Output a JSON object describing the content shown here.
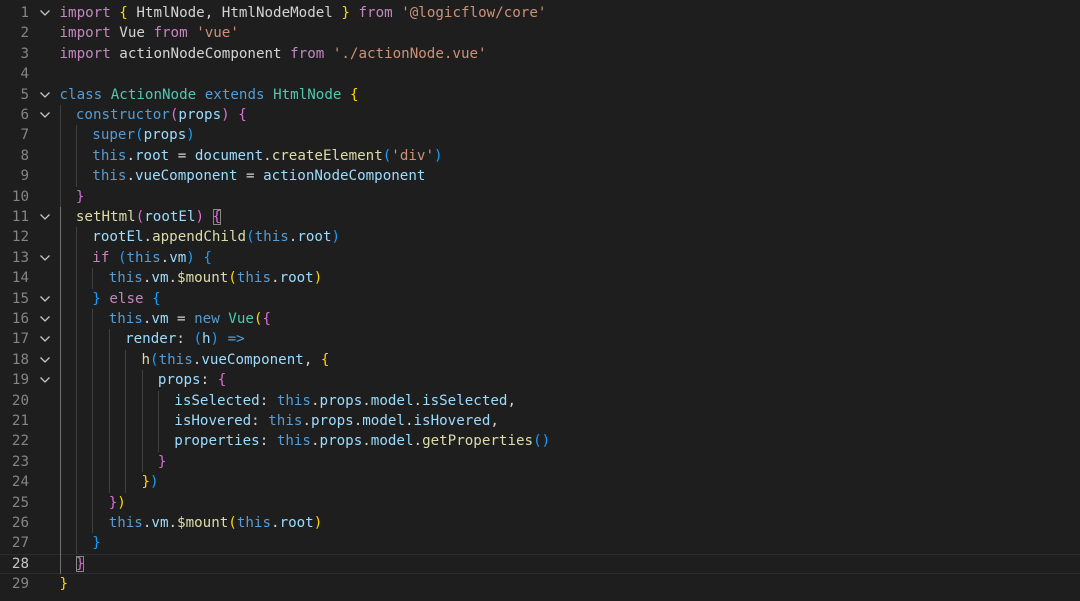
{
  "colors": {
    "background": "#1e1e1e",
    "line_number": "#858585",
    "line_number_active": "#c6c6c6",
    "keyword_import": "#c586c0",
    "keyword": "#569cd6",
    "class_name": "#4ec9b0",
    "variable": "#9cdcfe",
    "function": "#dcdcaa",
    "string": "#ce9178",
    "plain": "#d4d4d4",
    "bracket_1": "#ffd700",
    "bracket_2": "#da70d6",
    "bracket_3": "#179fff"
  },
  "editor": {
    "active_line": 28,
    "lines": [
      {
        "n": "1",
        "fold": true,
        "indent": 0,
        "tokens": [
          [
            "import",
            "k"
          ],
          [
            " ",
            "p"
          ],
          [
            "{",
            "b1"
          ],
          [
            " HtmlNode, HtmlNodeModel ",
            "p"
          ],
          [
            "}",
            "b1"
          ],
          [
            " ",
            "p"
          ],
          [
            "from",
            "k"
          ],
          [
            " ",
            "p"
          ],
          [
            "'@logicflow/core'",
            "s"
          ]
        ]
      },
      {
        "n": "2",
        "fold": false,
        "indent": 0,
        "tokens": [
          [
            "import",
            "k"
          ],
          [
            " Vue ",
            "p"
          ],
          [
            "from",
            "k"
          ],
          [
            " ",
            "p"
          ],
          [
            "'vue'",
            "s"
          ]
        ]
      },
      {
        "n": "3",
        "fold": false,
        "indent": 0,
        "tokens": [
          [
            "import",
            "k"
          ],
          [
            " actionNodeComponent ",
            "p"
          ],
          [
            "from",
            "k"
          ],
          [
            " ",
            "p"
          ],
          [
            "'./actionNode.vue'",
            "s"
          ]
        ]
      },
      {
        "n": "4",
        "fold": false,
        "indent": 0,
        "tokens": []
      },
      {
        "n": "5",
        "fold": true,
        "indent": 0,
        "tokens": [
          [
            "class",
            "kw"
          ],
          [
            " ",
            "p"
          ],
          [
            "ActionNode",
            "c"
          ],
          [
            " ",
            "p"
          ],
          [
            "extends",
            "kw"
          ],
          [
            " ",
            "p"
          ],
          [
            "HtmlNode",
            "c"
          ],
          [
            " ",
            "p"
          ],
          [
            "{",
            "b1"
          ]
        ]
      },
      {
        "n": "6",
        "fold": true,
        "indent": 1,
        "tokens": [
          [
            "constructor",
            "kw"
          ],
          [
            "(",
            "b2"
          ],
          [
            "props",
            "v"
          ],
          [
            ")",
            "b2"
          ],
          [
            " ",
            "p"
          ],
          [
            "{",
            "b2"
          ]
        ]
      },
      {
        "n": "7",
        "fold": false,
        "indent": 2,
        "tokens": [
          [
            "super",
            "kw"
          ],
          [
            "(",
            "b3"
          ],
          [
            "props",
            "v"
          ],
          [
            ")",
            "b3"
          ]
        ]
      },
      {
        "n": "8",
        "fold": false,
        "indent": 2,
        "tokens": [
          [
            "this",
            "kw"
          ],
          [
            ".",
            "p"
          ],
          [
            "root",
            "v"
          ],
          [
            " = ",
            "p"
          ],
          [
            "document",
            "v"
          ],
          [
            ".",
            "p"
          ],
          [
            "createElement",
            "f"
          ],
          [
            "(",
            "b3"
          ],
          [
            "'div'",
            "s"
          ],
          [
            ")",
            "b3"
          ]
        ]
      },
      {
        "n": "9",
        "fold": false,
        "indent": 2,
        "tokens": [
          [
            "this",
            "kw"
          ],
          [
            ".",
            "p"
          ],
          [
            "vueComponent",
            "v"
          ],
          [
            " = ",
            "p"
          ],
          [
            "actionNodeComponent",
            "v"
          ]
        ]
      },
      {
        "n": "10",
        "fold": false,
        "indent": 1,
        "tokens": [
          [
            "}",
            "b2"
          ]
        ]
      },
      {
        "n": "11",
        "fold": true,
        "indent": 1,
        "tokens": [
          [
            "setHtml",
            "f"
          ],
          [
            "(",
            "b2"
          ],
          [
            "rootEl",
            "v"
          ],
          [
            ")",
            "b2"
          ],
          [
            " ",
            "p"
          ],
          [
            "{",
            "b2m"
          ]
        ]
      },
      {
        "n": "12",
        "fold": false,
        "indent": 2,
        "tokens": [
          [
            "rootEl",
            "v"
          ],
          [
            ".",
            "p"
          ],
          [
            "appendChild",
            "f"
          ],
          [
            "(",
            "b3"
          ],
          [
            "this",
            "kw"
          ],
          [
            ".",
            "p"
          ],
          [
            "root",
            "v"
          ],
          [
            ")",
            "b3"
          ]
        ]
      },
      {
        "n": "13",
        "fold": true,
        "indent": 2,
        "tokens": [
          [
            "if",
            "k"
          ],
          [
            " ",
            "p"
          ],
          [
            "(",
            "b3"
          ],
          [
            "this",
            "kw"
          ],
          [
            ".",
            "p"
          ],
          [
            "vm",
            "v"
          ],
          [
            ")",
            "b3"
          ],
          [
            " ",
            "p"
          ],
          [
            "{",
            "b3"
          ]
        ]
      },
      {
        "n": "14",
        "fold": false,
        "indent": 3,
        "tokens": [
          [
            "this",
            "kw"
          ],
          [
            ".",
            "p"
          ],
          [
            "vm",
            "v"
          ],
          [
            ".",
            "p"
          ],
          [
            "$mount",
            "f"
          ],
          [
            "(",
            "b1"
          ],
          [
            "this",
            "kw"
          ],
          [
            ".",
            "p"
          ],
          [
            "root",
            "v"
          ],
          [
            ")",
            "b1"
          ]
        ]
      },
      {
        "n": "15",
        "fold": true,
        "indent": 2,
        "tokens": [
          [
            "}",
            "b3"
          ],
          [
            " ",
            "p"
          ],
          [
            "else",
            "k"
          ],
          [
            " ",
            "p"
          ],
          [
            "{",
            "b3"
          ]
        ]
      },
      {
        "n": "16",
        "fold": true,
        "indent": 3,
        "tokens": [
          [
            "this",
            "kw"
          ],
          [
            ".",
            "p"
          ],
          [
            "vm",
            "v"
          ],
          [
            " = ",
            "p"
          ],
          [
            "new",
            "kw"
          ],
          [
            " ",
            "p"
          ],
          [
            "Vue",
            "c"
          ],
          [
            "(",
            "b1"
          ],
          [
            "{",
            "b2"
          ]
        ]
      },
      {
        "n": "17",
        "fold": true,
        "indent": 4,
        "tokens": [
          [
            "render",
            "v"
          ],
          [
            ": ",
            "p"
          ],
          [
            "(",
            "b3"
          ],
          [
            "h",
            "v"
          ],
          [
            ")",
            "b3"
          ],
          [
            " ",
            "p"
          ],
          [
            "=>",
            "kw"
          ]
        ]
      },
      {
        "n": "18",
        "fold": true,
        "indent": 5,
        "tokens": [
          [
            "h",
            "f"
          ],
          [
            "(",
            "b3"
          ],
          [
            "this",
            "kw"
          ],
          [
            ".",
            "p"
          ],
          [
            "vueComponent",
            "v"
          ],
          [
            ", ",
            "p"
          ],
          [
            "{",
            "b1"
          ]
        ]
      },
      {
        "n": "19",
        "fold": true,
        "indent": 6,
        "tokens": [
          [
            "props",
            "v"
          ],
          [
            ": ",
            "p"
          ],
          [
            "{",
            "b2"
          ]
        ]
      },
      {
        "n": "20",
        "fold": false,
        "indent": 7,
        "tokens": [
          [
            "isSelected",
            "v"
          ],
          [
            ": ",
            "p"
          ],
          [
            "this",
            "kw"
          ],
          [
            ".",
            "p"
          ],
          [
            "props",
            "v"
          ],
          [
            ".",
            "p"
          ],
          [
            "model",
            "v"
          ],
          [
            ".",
            "p"
          ],
          [
            "isSelected",
            "v"
          ],
          [
            ",",
            "p"
          ]
        ]
      },
      {
        "n": "21",
        "fold": false,
        "indent": 7,
        "tokens": [
          [
            "isHovered",
            "v"
          ],
          [
            ": ",
            "p"
          ],
          [
            "this",
            "kw"
          ],
          [
            ".",
            "p"
          ],
          [
            "props",
            "v"
          ],
          [
            ".",
            "p"
          ],
          [
            "model",
            "v"
          ],
          [
            ".",
            "p"
          ],
          [
            "isHovered",
            "v"
          ],
          [
            ",",
            "p"
          ]
        ]
      },
      {
        "n": "22",
        "fold": false,
        "indent": 7,
        "tokens": [
          [
            "properties",
            "v"
          ],
          [
            ": ",
            "p"
          ],
          [
            "this",
            "kw"
          ],
          [
            ".",
            "p"
          ],
          [
            "props",
            "v"
          ],
          [
            ".",
            "p"
          ],
          [
            "model",
            "v"
          ],
          [
            ".",
            "p"
          ],
          [
            "getProperties",
            "f"
          ],
          [
            "()",
            "b3"
          ]
        ]
      },
      {
        "n": "23",
        "fold": false,
        "indent": 6,
        "tokens": [
          [
            "}",
            "b2"
          ]
        ]
      },
      {
        "n": "24",
        "fold": false,
        "indent": 5,
        "tokens": [
          [
            "}",
            "b1"
          ],
          [
            ")",
            "b3"
          ]
        ]
      },
      {
        "n": "25",
        "fold": false,
        "indent": 3,
        "tokens": [
          [
            "}",
            "b2"
          ],
          [
            ")",
            "b1"
          ]
        ]
      },
      {
        "n": "26",
        "fold": false,
        "indent": 3,
        "tokens": [
          [
            "this",
            "kw"
          ],
          [
            ".",
            "p"
          ],
          [
            "vm",
            "v"
          ],
          [
            ".",
            "p"
          ],
          [
            "$mount",
            "f"
          ],
          [
            "(",
            "b1"
          ],
          [
            "this",
            "kw"
          ],
          [
            ".",
            "p"
          ],
          [
            "root",
            "v"
          ],
          [
            ")",
            "b1"
          ]
        ]
      },
      {
        "n": "27",
        "fold": false,
        "indent": 2,
        "tokens": [
          [
            "}",
            "b3"
          ]
        ]
      },
      {
        "n": "28",
        "fold": false,
        "indent": 1,
        "tokens": [
          [
            "}",
            "b2m"
          ]
        ]
      },
      {
        "n": "29",
        "fold": false,
        "indent": 0,
        "tokens": [
          [
            "}",
            "b1"
          ]
        ]
      }
    ]
  }
}
